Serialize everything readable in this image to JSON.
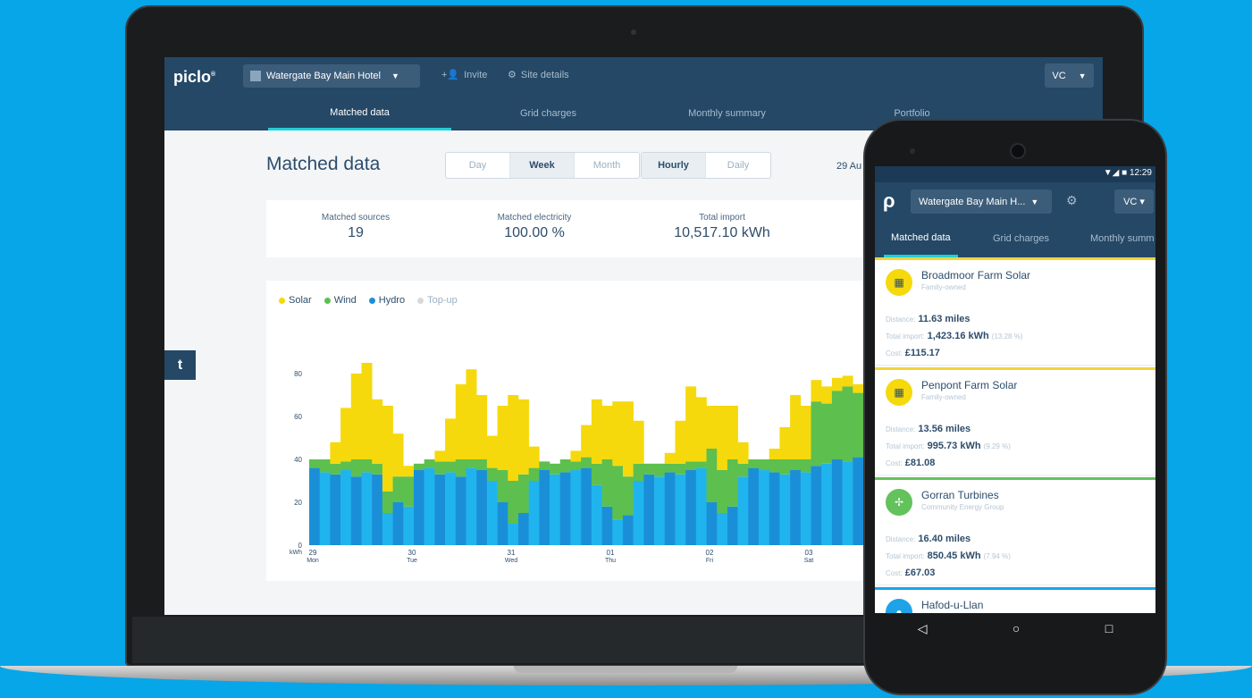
{
  "app": {
    "logo": "piclo",
    "site": "Watergate Bay Main Hotel",
    "invite_label": "Invite",
    "site_details_label": "Site details",
    "user": "VC"
  },
  "tabs": [
    {
      "label": "Matched data",
      "active": true
    },
    {
      "label": "Grid charges",
      "active": false
    },
    {
      "label": "Monthly summary",
      "active": false
    },
    {
      "label": "Portfolio",
      "active": false
    }
  ],
  "page": {
    "title": "Matched data",
    "period_options": [
      "Day",
      "Week",
      "Month"
    ],
    "period_selected": "Week",
    "resolution_options": [
      "Hourly",
      "Daily"
    ],
    "resolution_selected": "Hourly",
    "date_label": "29 Au"
  },
  "stats": [
    {
      "label": "Matched sources",
      "value": "19"
    },
    {
      "label": "Matched electricity",
      "value": "100.00 %"
    },
    {
      "label": "Total import",
      "value": "10,517.10 kWh"
    }
  ],
  "colors": {
    "solar": "#f5d90d",
    "wind": "#5dbf4e",
    "hydro": "#1a8fd8",
    "hydro_light": "#20b4ee",
    "topup": "#d6d9dc",
    "brand_dark": "#244866",
    "accent": "#1fd0d8"
  },
  "chart_data": {
    "type": "bar",
    "stacked": true,
    "legend": [
      "Solar",
      "Wind",
      "Hydro",
      "Top-up"
    ],
    "ylabel": "kWh",
    "y_ticks": [
      "0",
      "20",
      "40",
      "60",
      "80"
    ],
    "ylim": [
      0,
      90
    ],
    "x_ticks": [
      {
        "day": "29",
        "weekday": "Mon"
      },
      {
        "day": "30",
        "weekday": "Tue"
      },
      {
        "day": "31",
        "weekday": "Wed"
      },
      {
        "day": "01",
        "weekday": "Thu"
      },
      {
        "day": "02",
        "weekday": "Fri"
      },
      {
        "day": "03",
        "weekday": "Sat"
      }
    ],
    "series": [
      {
        "name": "Hydro",
        "values": [
          36,
          34,
          33,
          35,
          32,
          34,
          33,
          15,
          20,
          18,
          35,
          36,
          33,
          34,
          32,
          36,
          35,
          30,
          20,
          10,
          15,
          30,
          35,
          33,
          34,
          35,
          36,
          28,
          18,
          12,
          14,
          30,
          33,
          32,
          34,
          33,
          35,
          36,
          20,
          15,
          18,
          32,
          36,
          35,
          34,
          33,
          35,
          34,
          37,
          38,
          40,
          39,
          41
        ]
      },
      {
        "name": "Wind",
        "values": [
          4,
          6,
          5,
          4,
          8,
          6,
          5,
          10,
          12,
          14,
          3,
          4,
          6,
          5,
          8,
          4,
          5,
          6,
          15,
          20,
          18,
          6,
          4,
          5,
          6,
          4,
          5,
          10,
          22,
          25,
          18,
          8,
          5,
          6,
          4,
          5,
          4,
          3,
          25,
          20,
          22,
          6,
          4,
          5,
          6,
          7,
          5,
          6,
          30,
          28,
          32,
          35,
          30
        ]
      },
      {
        "name": "Solar",
        "values": [
          0,
          0,
          10,
          25,
          40,
          45,
          30,
          40,
          20,
          5,
          0,
          0,
          5,
          20,
          35,
          42,
          30,
          15,
          30,
          40,
          35,
          10,
          0,
          0,
          0,
          5,
          15,
          30,
          25,
          30,
          35,
          20,
          0,
          0,
          5,
          20,
          35,
          30,
          20,
          30,
          25,
          10,
          0,
          0,
          5,
          15,
          30,
          25,
          10,
          8,
          6,
          5,
          4
        ]
      }
    ]
  },
  "phone": {
    "status_time": "12:29",
    "site": "Watergate Bay Main H...",
    "user": "VC",
    "tabs": [
      "Matched data",
      "Grid charges",
      "Monthly summ"
    ],
    "cards": [
      {
        "name": "Broadmoor Farm Solar",
        "owner": "Family-owned",
        "distance_label": "Distance:",
        "distance": "11.63 miles",
        "import_label": "Total import:",
        "import": "1,423.16 kWh",
        "pct": "(13.28 %)",
        "cost_label": "Cost:",
        "cost": "£115.17",
        "type": "solar"
      },
      {
        "name": "Penpont Farm Solar",
        "owner": "Family-owned",
        "distance_label": "Distance:",
        "distance": "13.56 miles",
        "import_label": "Total import:",
        "import": "995.73 kWh",
        "pct": "(9.29 %)",
        "cost_label": "Cost:",
        "cost": "£81.08",
        "type": "solar"
      },
      {
        "name": "Gorran Turbines",
        "owner": "Community Energy Group",
        "distance_label": "Distance:",
        "distance": "16.40 miles",
        "import_label": "Total import:",
        "import": "850.45 kWh",
        "pct": "(7.94 %)",
        "cost_label": "Cost:",
        "cost": "£67.03",
        "type": "wind"
      },
      {
        "name": "Hafod-u-Llan",
        "type": "hydro"
      }
    ]
  }
}
